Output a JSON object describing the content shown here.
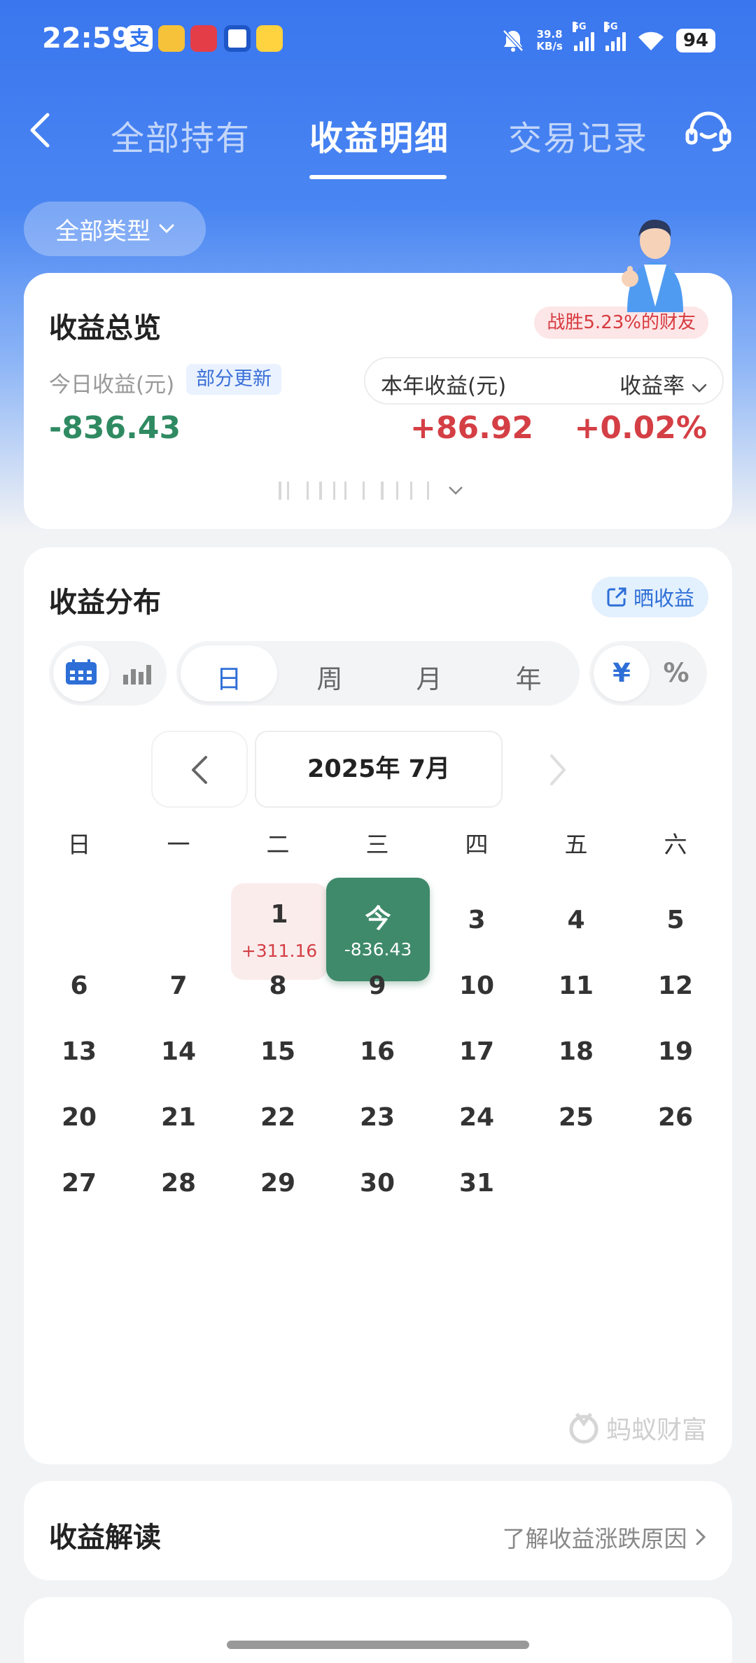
{
  "status_bar": {
    "time": "22:59",
    "speed_value": "39.8",
    "speed_unit": "KB/s",
    "sim1": "5G",
    "sim2": "5G",
    "battery": "94"
  },
  "nav": {
    "tabs": [
      "全部持有",
      "收益明细",
      "交易记录"
    ],
    "active_tab": "收益明细"
  },
  "filter": {
    "type_label": "全部类型"
  },
  "overview": {
    "title": "收益总览",
    "beat_text": "战胜5.23%的财友",
    "today_label": "今日收益(元)",
    "update_badge": "部分更新",
    "year_label": "本年收益(元)",
    "rate_label": "收益率",
    "today_value": "-836.43",
    "year_value": "+86.92",
    "rate_value": "+0.02%"
  },
  "distribution": {
    "title": "收益分布",
    "share_label": "晒收益",
    "period_options": [
      "日",
      "周",
      "月",
      "年"
    ],
    "selected_period": "日",
    "unit_options": [
      "¥",
      "%"
    ],
    "selected_unit": "¥",
    "month_label": "2025年 7月",
    "weekdays": [
      "日",
      "一",
      "二",
      "三",
      "四",
      "五",
      "六"
    ],
    "days": [
      "3",
      "4",
      "5",
      "6",
      "7",
      "8",
      "9",
      "10",
      "11",
      "12",
      "13",
      "14",
      "15",
      "16",
      "17",
      "18",
      "19",
      "20",
      "21",
      "22",
      "23",
      "24",
      "25",
      "26",
      "27",
      "28",
      "29",
      "30",
      "31"
    ],
    "day1": {
      "date": "1",
      "value": "+311.16"
    },
    "today": {
      "label": "今",
      "value": "-836.43"
    },
    "watermark": "蚂蚁财富"
  },
  "interpretation": {
    "title": "收益解读",
    "link": "了解收益涨跌原因"
  },
  "colors": {
    "header_blue": "#3a76ee",
    "gain_red": "#d43f45",
    "loss_green": "#2f8a62",
    "accent_blue": "#2e6fd7"
  }
}
